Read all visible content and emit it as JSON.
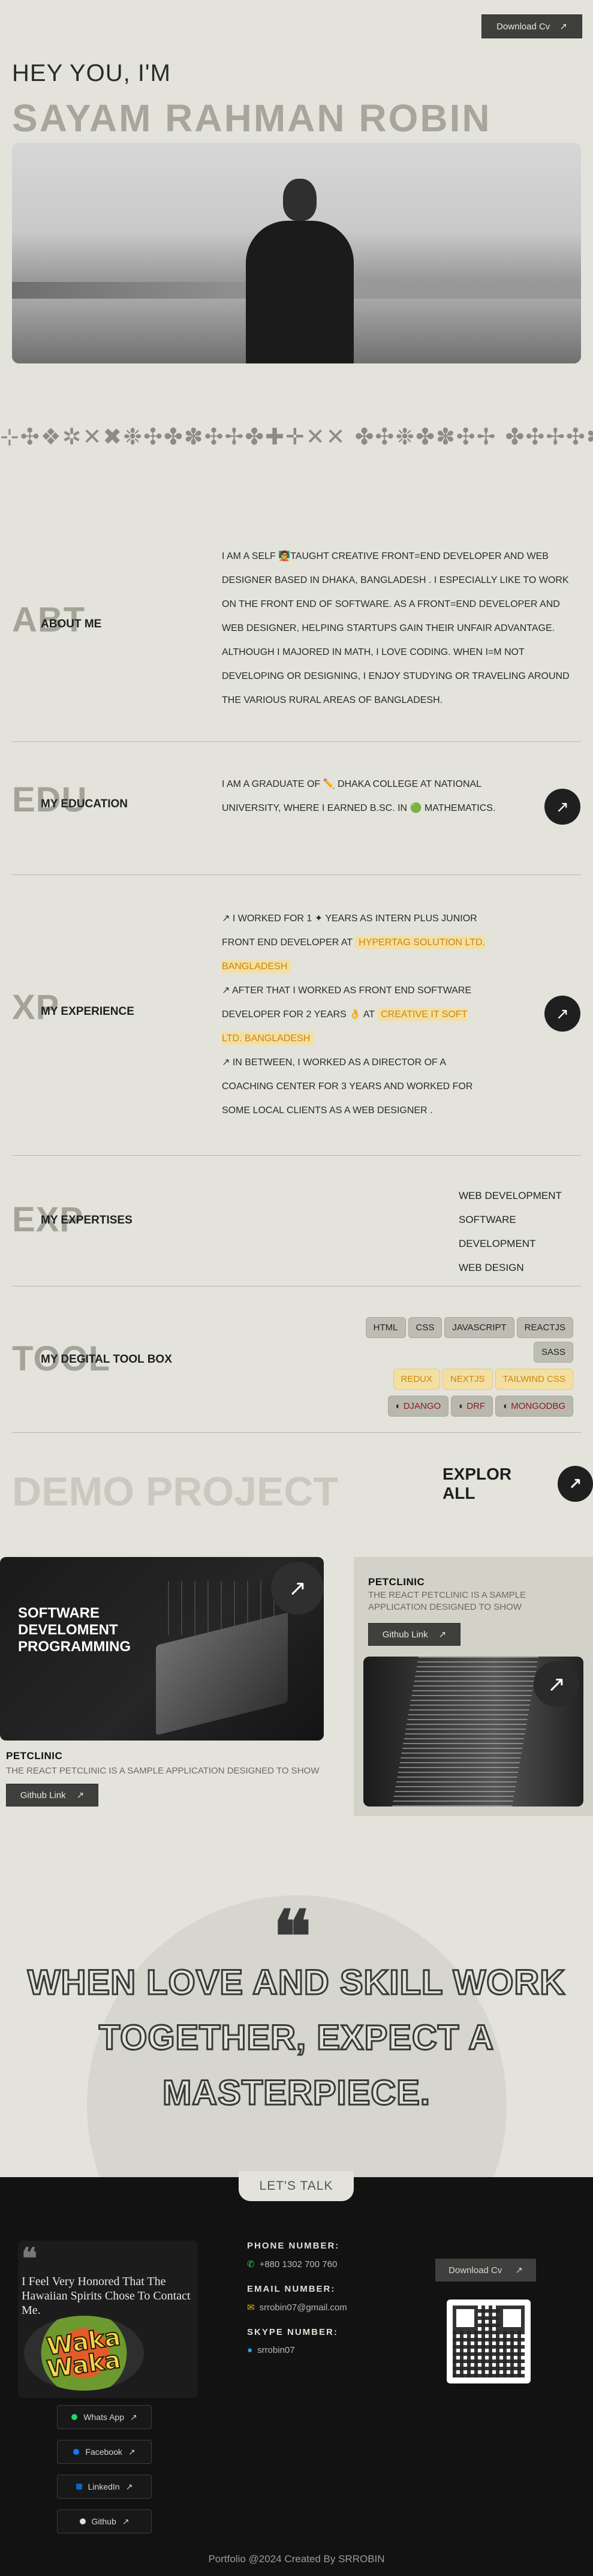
{
  "header": {
    "download_cv": "Download Cv",
    "arrow": "↗"
  },
  "hero": {
    "greeting": "HEY YOU, I'M",
    "name": "SAYAM RAHMAN ROBIN"
  },
  "symbol_strip": "⊹✣❖✲✕✖❉✣✤✽✣✢✤✚✛✕✕ ✤✣❉✤✽✣✢ ✤✣✢✣✽✛✚✕✤✢✧✻",
  "about": {
    "ghost": "ABT",
    "label": "ABOUT ME",
    "text": "I AM A SELF 🧑‍🏫TAUGHT CREATIVE FRONT=END DEVELOPER AND WEB DESIGNER BASED IN DHAKA, BANGLADESH . I ESPECIALLY LIKE TO WORK ON THE FRONT END OF SOFTWARE. AS A FRONT=END DEVELOPER AND WEB DESIGNER, HELPING STARTUPS GAIN THEIR UNFAIR ADVANTAGE. ALTHOUGH I MAJORED IN MATH, I LOVE CODING. WHEN I=M NOT DEVELOPING OR DESIGNING, I ENJOY STUDYING OR TRAVELING AROUND THE VARIOUS RURAL AREAS OF BANGLADESH."
  },
  "education": {
    "ghost": "EDU",
    "label": "MY EDUCATION",
    "text": "I AM A GRADUATE OF ✏️ DHAKA COLLEGE AT NATIONAL UNIVERSITY, WHERE I EARNED B.SC. IN 🟢 MATHEMATICS."
  },
  "experience": {
    "ghost": "XP",
    "label": "MY EXPERIENCE",
    "line1_a": "↗ I WORKED FOR 1 ✦ YEARS AS INTERN PLUS JUNIOR FRONT END DEVELOPER AT",
    "company1": "HYPERTAG SOLUTION LTD. BANGLADESH",
    "line2_a": "↗ AFTER THAT I WORKED AS FRONT END SOFTWARE DEVELOPER FOR 2 YEARS 👌 AT",
    "company2": "CREATIVE IT SOFT LTD. BANGLADESH",
    "line3": "↗ IN BETWEEN, I WORKED AS A DIRECTOR OF A COACHING CENTER FOR 3 YEARS AND WORKED FOR SOME LOCAL CLIENTS AS A WEB DESIGNER ."
  },
  "expertise": {
    "ghost": "EXP",
    "label": "MY EXPERTISES",
    "items": [
      "WEB DEVELOPMENT",
      "SOFTWARE DEVELOPMENT",
      "WEB DESIGN"
    ]
  },
  "toolbox": {
    "ghost": "TOOL",
    "label": "MY DEGITAL TOOL BOX",
    "row1": [
      "HTML",
      "CSS",
      "JAVASCRIPT",
      "REACTJS",
      "SASS"
    ],
    "row2": [
      "REDUX",
      "NEXTJS",
      "TAILWIND CSS"
    ],
    "row3": [
      "DJANGO",
      "DRF",
      "MONGODBG"
    ]
  },
  "demo": {
    "title": "DEMO PROJECT",
    "explore": "EXPLOR ALL"
  },
  "projects": [
    {
      "image_text": "SOFTWARE DEVELOMENT PROGRAMMING",
      "title": "PETCLINIC",
      "desc": "THE REACT PETCLINIC IS A SAMPLE APPLICATION DESIGNED TO SHOW",
      "btn": "Github Link"
    },
    {
      "title": "PETCLINIC",
      "desc": "THE REACT PETCLINIC IS A SAMPLE APPLICATION DESIGNED TO SHOW",
      "btn": "Github Link"
    }
  ],
  "quote": "WHEN LOVE AND SKILL WORK TOGETHER, EXPECT A MASTERPIECE.",
  "footer": {
    "tab": "LET'S TALK",
    "testimonial": "I Feel Very Honored That The Hawaiian Spirits Chose To Contact Me.",
    "logo_line1": "Waka",
    "logo_line2": "Waka",
    "socials": [
      "Whats App",
      "Facebook",
      "LinkedIn",
      "Github"
    ],
    "phone_h": "PHONE NUMBER:",
    "phone_v": "+880 1302 700 760",
    "email_h": "EMAIL NUMBER:",
    "email_v": "srrobin07@gmail.com",
    "skype_h": "SKYPE NUMBER:",
    "skype_v": "srrobin07",
    "download_cv": "Download Cv",
    "copyright": "Portfolio @2024 Created By SRROBIN"
  },
  "colors": {
    "bg": "#e3e3dc",
    "accent_yellow": "#f4dfa2",
    "dark": "#121212"
  }
}
